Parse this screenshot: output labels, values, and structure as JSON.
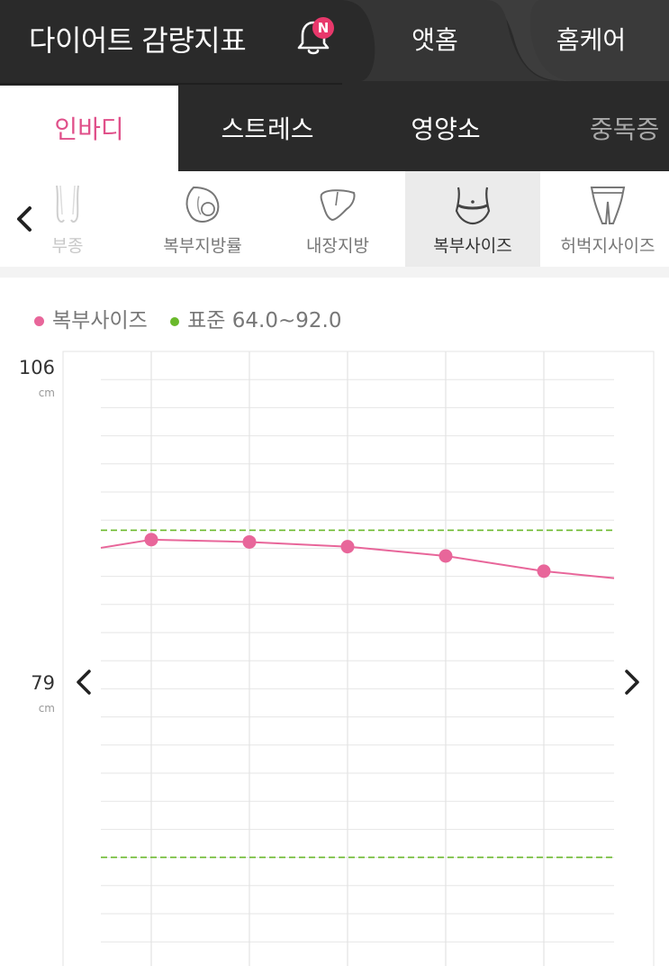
{
  "header": {
    "app_title": "다이어트 감량지표",
    "notification_badge": "N",
    "tabs": [
      {
        "label": "앳홈"
      },
      {
        "label": "홈케어"
      }
    ]
  },
  "category_tabs": [
    {
      "label": "인바디",
      "active": true
    },
    {
      "label": "스트레스",
      "active": false
    },
    {
      "label": "영양소",
      "active": false
    },
    {
      "label": "중독증",
      "active": false
    }
  ],
  "metrics": [
    {
      "label": "부종",
      "icon": "legs-icon",
      "active": false
    },
    {
      "label": "복부지방률",
      "icon": "belly-fat-icon",
      "active": false
    },
    {
      "label": "내장지방",
      "icon": "liver-icon",
      "active": false
    },
    {
      "label": "복부사이즈",
      "icon": "waist-icon",
      "active": true
    },
    {
      "label": "허벅지사이즈",
      "icon": "thigh-icon",
      "active": false
    }
  ],
  "legend": {
    "series_label": "복부사이즈",
    "standard_label": "표준 64.0~92.0"
  },
  "colors": {
    "accent": "#e0508a",
    "series": "#e8669a",
    "standard": "#6ab92b",
    "dark_bg": "#2a2a2a"
  },
  "chart_data": {
    "type": "line",
    "y_ticks": [
      {
        "value": 106,
        "label": "106",
        "unit": "cm"
      },
      {
        "value": 79,
        "label": "79",
        "unit": "cm"
      }
    ],
    "ylim": [
      58,
      106
    ],
    "standard_range": [
      64.0,
      92.0
    ],
    "grid": true,
    "series": [
      {
        "values": [
          91.2,
          91.0,
          90.6,
          89.8,
          88.5
        ],
        "lead_in": 90.5,
        "lead_out": 87.9
      }
    ]
  }
}
